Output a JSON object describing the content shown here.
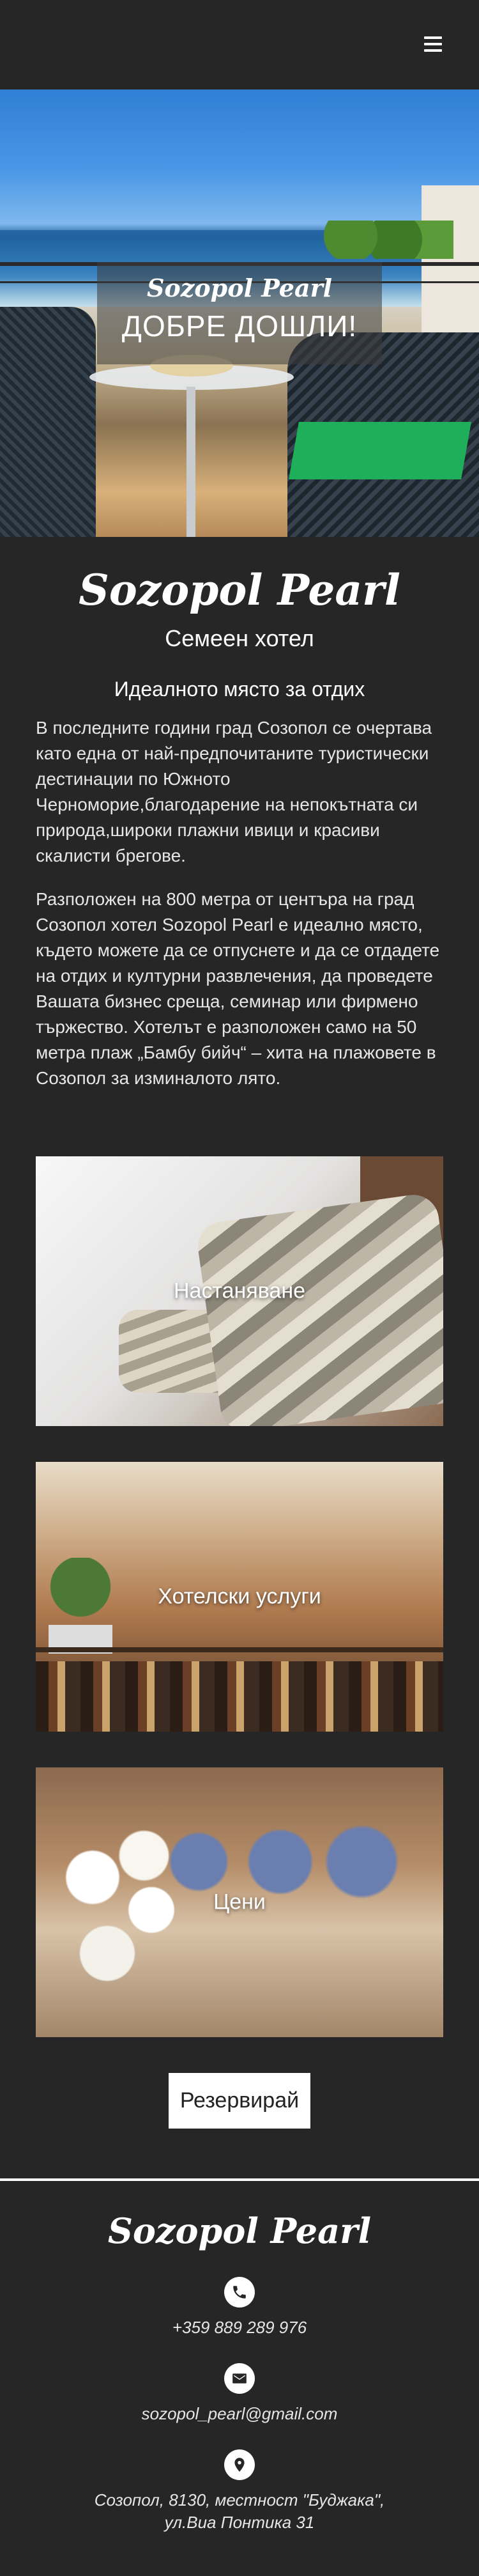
{
  "header": {
    "menu_icon": "hamburger-menu-icon"
  },
  "hero": {
    "brand": "Sozopol Pearl",
    "welcome": "ДОБРЕ ДОШЛИ!"
  },
  "intro": {
    "brand": "Sozopol Pearl",
    "subtitle": "Семеен хотел",
    "tagline": "Идеалното място за отдих",
    "paragraphs": [
      "В последните години град Созопол се очертава като една от най-предпочитаните туристически дестинации по Южното Черноморие,благодарение на непокътната си природа,широки плажни ивици и красиви скалисти брегове.",
      "Разположен на 800 метра от центъра на град Созопол хотел Sozopol Pearl е идеално място, където можете да се отпуснете и да се отдадете на отдих и културни развлечения, да проведете Вашата бизнес среща, семинар или фирмено тържество. Хотелът е разположен само на 50 метра плаж „Бамбу бийч“ – хита на плажовете в Созопол за изминалото лято."
    ]
  },
  "cards": [
    {
      "label": "Настаняване"
    },
    {
      "label": "Хотелски услуги"
    },
    {
      "label": "Цени"
    }
  ],
  "reserve_label": "Резервирай",
  "footer": {
    "brand": "Sozopol Pearl",
    "phone": "+359 889 289 976",
    "email": "sozopol_pearl@gmail.com",
    "address_line1": "Созопол, 8130, местност \"Буджака\",",
    "address_line2": "ул.Виа Понтика 31",
    "icons": [
      "phone-icon",
      "email-icon",
      "location-pin-icon"
    ]
  }
}
